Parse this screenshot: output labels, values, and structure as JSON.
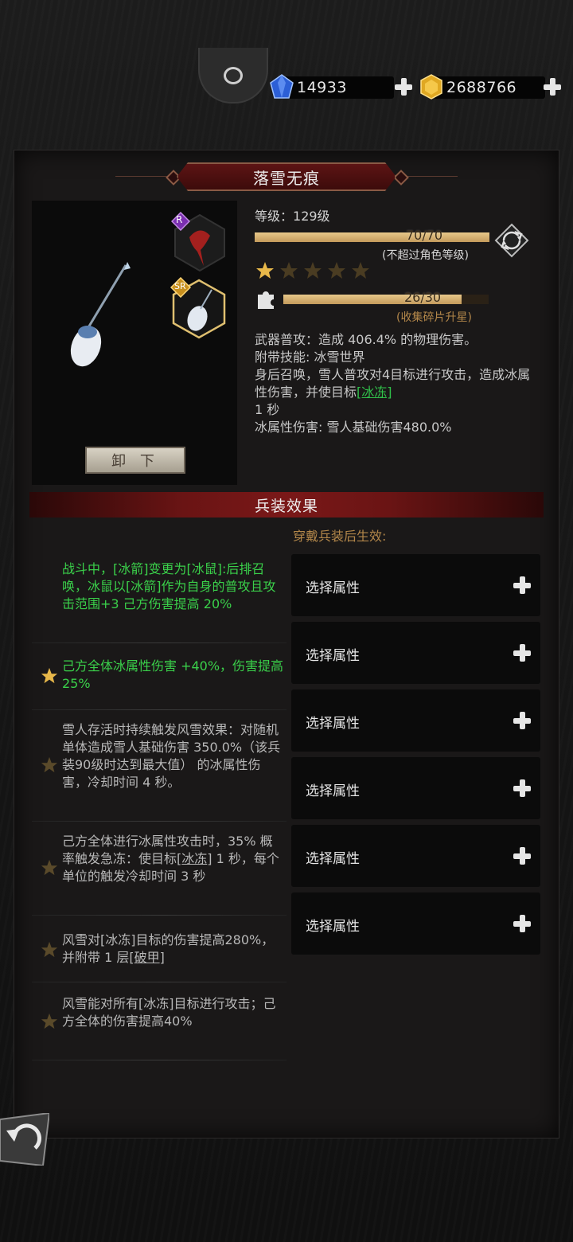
{
  "currency": {
    "diamond": "14933",
    "gold": "2688766"
  },
  "item": {
    "name": "落雪无痕",
    "unload_label": "卸 下",
    "rarity_badge_1": "R",
    "rarity_badge_2": "SR",
    "level_label": "等级：",
    "level_value": "129级",
    "level_progress": "70/70",
    "level_progress_fraction": 1.0,
    "level_note": "(不超过角色等级)",
    "stars_filled": 1,
    "stars_total": 5,
    "fragment_progress": "26/30",
    "fragment_progress_fraction": 0.867,
    "fragment_note": "(收集碎片升星)",
    "desc_line_1": "武器普攻：造成 406.4% 的物理伤害。",
    "desc_skill_title": "附带技能: 冰雪世界",
    "desc_skill_text_pre": "身后召唤，雪人普攻对4目标进行攻击，造成冰属性伤害，并使目标",
    "desc_skill_tag": "[冰冻]",
    "desc_skill_text_post": "1 秒",
    "desc_damage": "冰属性伤害: 雪人基础伤害480.0%"
  },
  "effects": {
    "header": "兵装效果",
    "note": "穿戴兵装后生效:",
    "items": [
      {
        "text": "战斗中，[冰箭]变更为[冰鼠]:后排召唤，冰鼠以[冰箭]作为自身的普攻且攻击范围+3 己方伤害提高 20%",
        "active": true
      },
      {
        "text": "己方全体冰属性伤害 +40%，伤害提高 25%",
        "active": true
      },
      {
        "text": "雪人存活时持续触发风雪效果：对随机单体造成雪人基础伤害 350.0%（该兵装90级时达到最大值） 的冰属性伤害，冷却时间 4 秒。",
        "active": false
      },
      {
        "text_pre": "己方全体进行冰属性攻击时，35% 概率触发急冻：使目标[",
        "tag": "冰冻",
        "text_post": "] 1 秒，每个单位的触发冷却时间 3 秒",
        "active": false
      },
      {
        "text_pre": "风雪对[冰冻]目标的伤害提高280%，并附带 1 层[",
        "tag": "破甲",
        "text_post": "]",
        "active": false
      },
      {
        "text": "风雪能对所有[冰冻]目标进行攻击；己方全体的伤害提高40%",
        "active": false
      }
    ]
  },
  "slots": [
    {
      "label": "选择属性"
    },
    {
      "label": "选择属性"
    },
    {
      "label": "选择属性"
    },
    {
      "label": "选择属性"
    },
    {
      "label": "选择属性"
    },
    {
      "label": "选择属性"
    }
  ],
  "colors": {
    "accent_gold": "#c39a5b",
    "active_green": "#3ad04a",
    "title_red": "#5d1414"
  }
}
